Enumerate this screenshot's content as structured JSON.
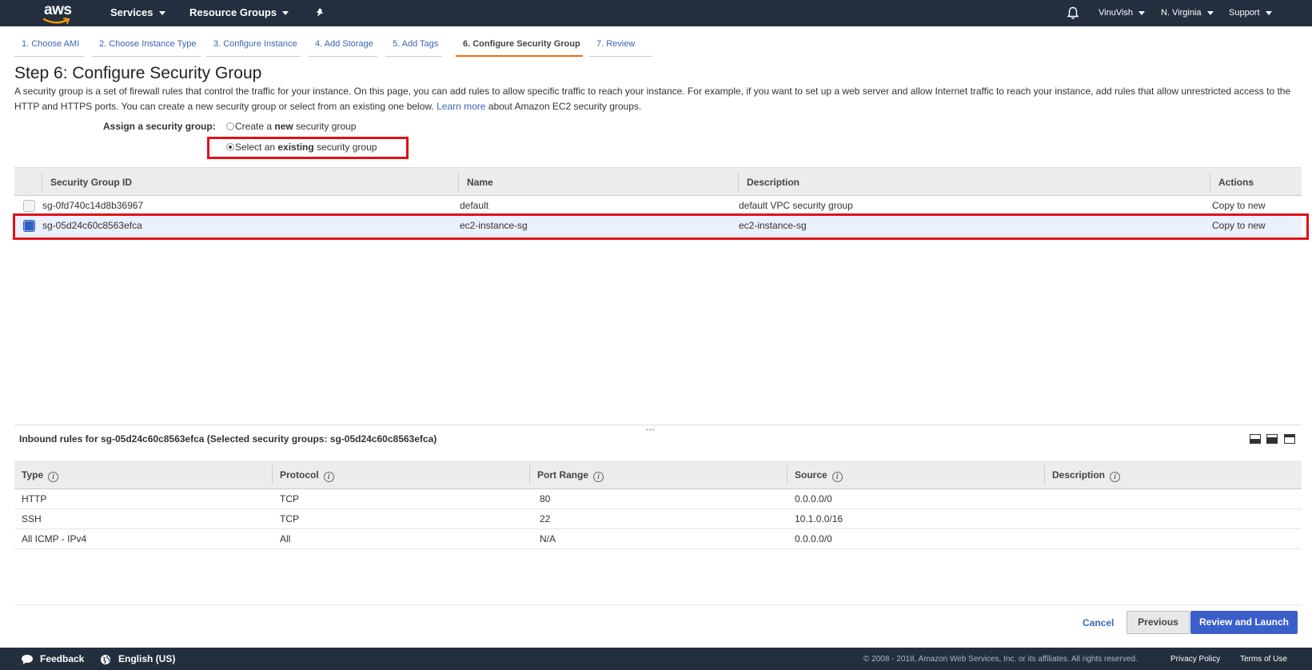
{
  "topnav": {
    "logo": "aws",
    "services": "Services",
    "resource_groups": "Resource Groups",
    "user": "VinuVish",
    "region": "N. Virginia",
    "support": "Support"
  },
  "wizard_tabs": [
    "1. Choose AMI",
    "2. Choose Instance Type",
    "3. Configure Instance",
    "4. Add Storage",
    "5. Add Tags",
    "6. Configure Security Group",
    "7. Review"
  ],
  "active_tab_index": 5,
  "page": {
    "title": "Step 6: Configure Security Group",
    "intro_text": "A security group is a set of firewall rules that control the traffic for your instance. On this page, you can add rules to allow specific traffic to reach your instance. For example, if you want to set up a web server and allow Internet traffic to reach your instance, add rules that allow unrestricted access to the HTTP and HTTPS ports. You can create a new security group or select from an existing one below.",
    "learn_more": "Learn more",
    "learn_more_suffix": "about Amazon EC2 security groups."
  },
  "assign": {
    "label": "Assign a security group:",
    "option_new_prefix": "Create a ",
    "option_new_bold": "new",
    "option_new_suffix": " security group",
    "option_existing_prefix": "Select an ",
    "option_existing_bold": "existing",
    "option_existing_suffix": " security group",
    "selected": "existing"
  },
  "sg_table": {
    "columns": [
      "Security Group ID",
      "Name",
      "Description",
      "Actions"
    ],
    "rows": [
      {
        "id": "sg-0fd740c14d8b36967",
        "name": "default",
        "description": "default VPC security group",
        "action": "Copy to new",
        "selected": false
      },
      {
        "id": "sg-05d24c60c8563efca",
        "name": "ec2-instance-sg",
        "description": "ec2-instance-sg",
        "action": "Copy to new",
        "selected": true
      }
    ]
  },
  "inbound": {
    "title": "Inbound rules for sg-05d24c60c8563efca (Selected security groups: sg-05d24c60c8563efca)",
    "columns": [
      "Type",
      "Protocol",
      "Port Range",
      "Source",
      "Description"
    ],
    "rows": [
      {
        "type": "HTTP",
        "protocol": "TCP",
        "port": "80",
        "source": "0.0.0.0/0",
        "description": ""
      },
      {
        "type": "SSH",
        "protocol": "TCP",
        "port": "22",
        "source": "10.1.0.0/16",
        "description": ""
      },
      {
        "type": "All ICMP - IPv4",
        "protocol": "All",
        "port": "N/A",
        "source": "0.0.0.0/0",
        "description": ""
      }
    ]
  },
  "buttons": {
    "cancel": "Cancel",
    "previous": "Previous",
    "review_launch": "Review and Launch"
  },
  "footer": {
    "feedback": "Feedback",
    "language": "English (US)",
    "copyright": "© 2008 - 2018, Amazon Web Services, Inc. or its affiliates. All rights reserved.",
    "privacy": "Privacy Policy",
    "terms": "Terms of Use"
  },
  "colors": {
    "nav_bg": "#232f3e",
    "accent_orange": "#ec7211",
    "link_blue": "#3a64b5",
    "primary_button": "#3b5fc8",
    "highlight_red": "#e0101a",
    "selected_row": "#eaf0fc"
  },
  "icons": [
    "aws-logo",
    "pin-icon",
    "bell-icon",
    "chevron-down-icon",
    "info-icon",
    "feedback-bubble-icon",
    "globe-icon",
    "pane-layout-icon"
  ]
}
